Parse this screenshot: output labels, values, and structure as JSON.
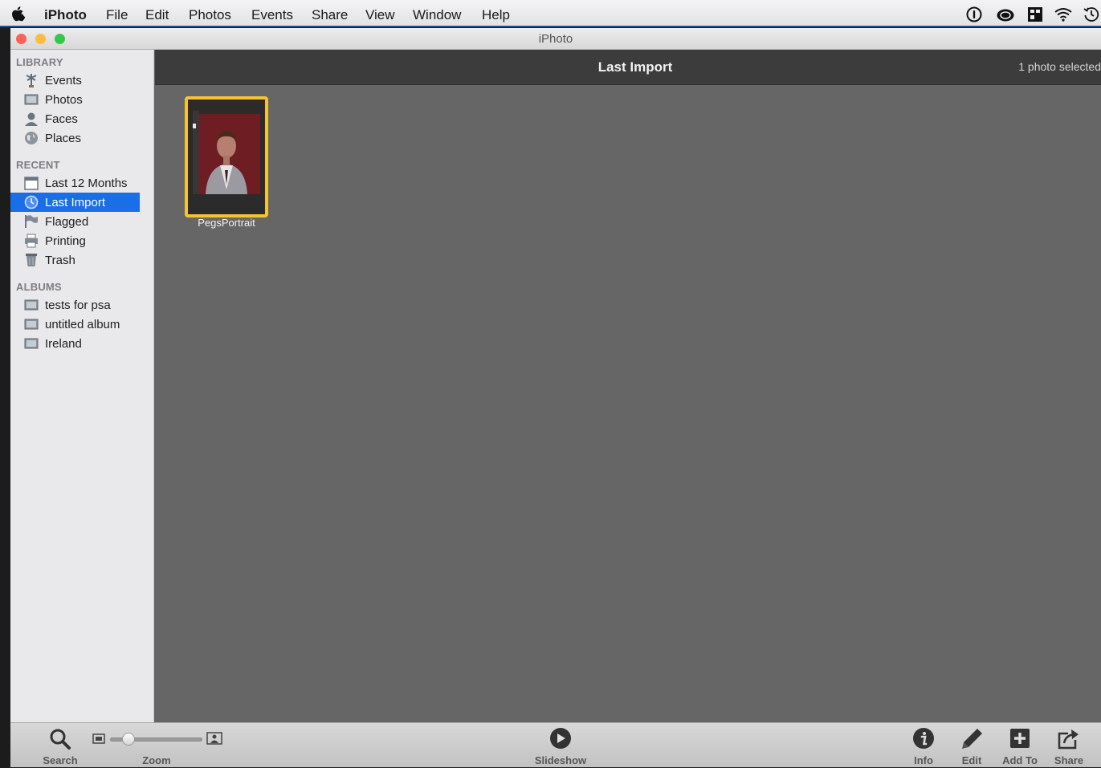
{
  "menubar": {
    "app": "iPhoto",
    "items": [
      "File",
      "Edit",
      "Photos",
      "Events",
      "Share",
      "View",
      "Window",
      "Help"
    ]
  },
  "window": {
    "title": "iPhoto"
  },
  "sidebar": {
    "library": {
      "heading": "LIBRARY",
      "items": [
        {
          "label": "Events",
          "icon": "events-icon"
        },
        {
          "label": "Photos",
          "icon": "photos-icon"
        },
        {
          "label": "Faces",
          "icon": "faces-icon"
        },
        {
          "label": "Places",
          "icon": "places-icon"
        }
      ]
    },
    "recent": {
      "heading": "RECENT",
      "items": [
        {
          "label": "Last 12 Months",
          "icon": "calendar-icon"
        },
        {
          "label": "Last Import",
          "icon": "clock-icon",
          "selected": true
        },
        {
          "label": "Flagged",
          "icon": "flag-icon"
        },
        {
          "label": "Printing",
          "icon": "printer-icon"
        },
        {
          "label": "Trash",
          "icon": "trash-icon"
        }
      ]
    },
    "albums": {
      "heading": "ALBUMS",
      "items": [
        {
          "label": "tests for psa",
          "icon": "album-icon"
        },
        {
          "label": "untitled album",
          "icon": "album-icon"
        },
        {
          "label": "Ireland",
          "icon": "album-icon"
        }
      ]
    }
  },
  "main": {
    "title": "Last Import",
    "selection_count": "1 photo selected",
    "photos": [
      {
        "caption": "PegsPortrait",
        "selected": true
      }
    ]
  },
  "toolbar": {
    "search": "Search",
    "zoom": "Zoom",
    "zoom_level": 0.15,
    "slideshow": "Slideshow",
    "info": "Info",
    "edit": "Edit",
    "add_to": "Add To",
    "share": "Share"
  },
  "colors": {
    "selection": "#1a6ee8",
    "thumb_border": "#f4c531",
    "content_bg": "#666666",
    "close": "#fc605c",
    "minimize": "#fdbc40",
    "zoom": "#34c84a"
  }
}
